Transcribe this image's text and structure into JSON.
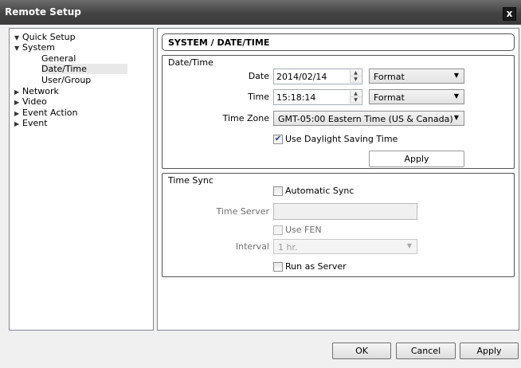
{
  "window": {
    "title": "Remote Setup",
    "close_label": "x"
  },
  "tree": {
    "items": [
      {
        "label": "Quick Setup",
        "arrow": "▼"
      },
      {
        "label": "System",
        "arrow": "▼"
      },
      {
        "label": "General",
        "arrow": ""
      },
      {
        "label": "Date/Time",
        "arrow": "",
        "selected": true
      },
      {
        "label": "User/Group",
        "arrow": ""
      },
      {
        "label": "Network",
        "arrow": "▶"
      },
      {
        "label": "Video",
        "arrow": "▶"
      },
      {
        "label": "Event Action",
        "arrow": "▶"
      },
      {
        "label": "Event",
        "arrow": "▶"
      }
    ]
  },
  "page": {
    "header": "SYSTEM / DATE/TIME"
  },
  "datetime": {
    "group_title": "Date/Time",
    "date_label": "Date",
    "date_value": "2014/02/14",
    "date_format": "Format",
    "time_label": "Time",
    "time_value": "15:18:14",
    "time_format": "Format",
    "timezone_label": "Time Zone",
    "timezone_value": "GMT-05:00 Eastern Time (US & Canada)",
    "dst_label": "Use Daylight Saving Time",
    "dst_checked": true,
    "apply_label": "Apply"
  },
  "timesync": {
    "group_title": "Time Sync",
    "auto_sync_label": "Automatic Sync",
    "auto_sync_checked": false,
    "server_label": "Time Server",
    "server_value": "",
    "use_fen_label": "Use FEN",
    "interval_label": "Interval",
    "interval_value": "1 hr.",
    "run_as_server_label": "Run as Server",
    "run_as_server_checked": false
  },
  "footer": {
    "ok_label": "OK",
    "cancel_label": "Cancel",
    "apply_label": "Apply"
  },
  "icons": {
    "spin_up": "▲",
    "spin_down": "▼",
    "dropdown": "▼",
    "check": "✔"
  },
  "colors": {
    "titlebar": "#434343",
    "panel_bg": "#f0f0f0",
    "border": "#828790"
  }
}
